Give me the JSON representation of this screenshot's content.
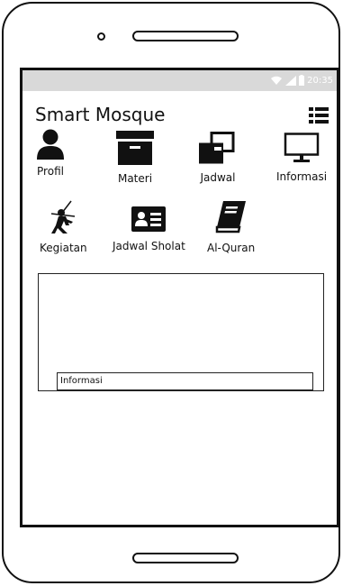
{
  "status_bar": {
    "time": "20:35",
    "wifi_icon": "wifi-icon",
    "signal_icon": "signal-icon",
    "battery_icon": "battery-icon",
    "bar_color": "#d9d9d9"
  },
  "header": {
    "title": "Smart Mosque",
    "menu_icon": "list-menu-icon"
  },
  "menu": {
    "items": [
      {
        "label": "Profil",
        "icon": "user-icon"
      },
      {
        "label": "Materi",
        "icon": "archive-box-icon"
      },
      {
        "label": "Jadwal",
        "icon": "clone-icon"
      },
      {
        "label": "Informasi",
        "icon": "monitor-icon"
      },
      {
        "label": "Kegiatan",
        "icon": "ninja-icon"
      },
      {
        "label": "Jadwal Sholat",
        "icon": "id-card-icon"
      },
      {
        "label": "Al-Quran",
        "icon": "book-icon"
      }
    ]
  },
  "info_panel": {
    "field_value": "Informasi"
  }
}
